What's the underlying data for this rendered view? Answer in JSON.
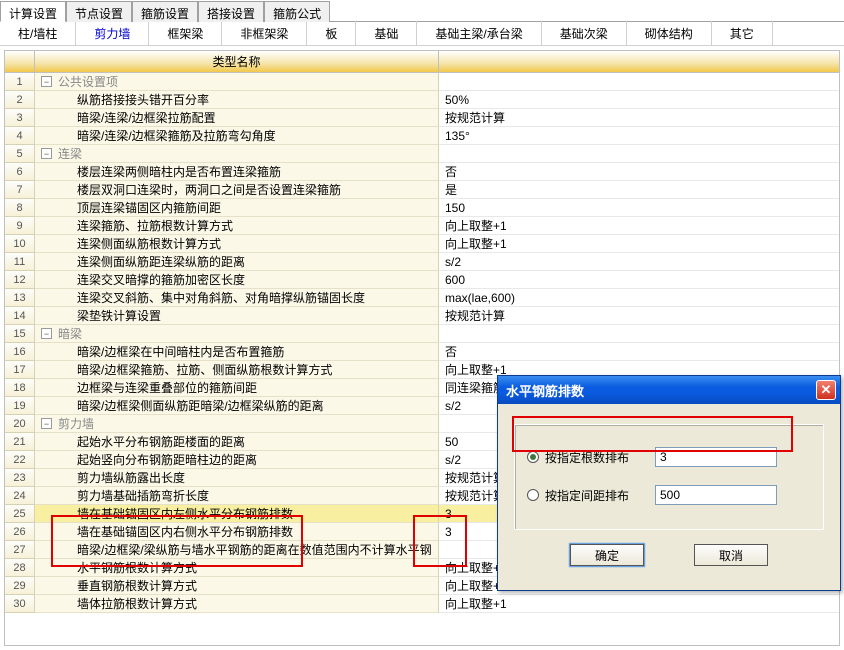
{
  "top_tabs": {
    "items": [
      "计算设置",
      "节点设置",
      "箍筋设置",
      "搭接设置",
      "箍筋公式"
    ],
    "active_index": 0
  },
  "sub_tabs": {
    "items": [
      "柱/墙柱",
      "剪力墙",
      "框架梁",
      "非框架梁",
      "板",
      "基础",
      "基础主梁/承台梁",
      "基础次梁",
      "砌体结构",
      "其它"
    ],
    "active_index": 1
  },
  "table_header": {
    "name_col": "类型名称",
    "value_col": ""
  },
  "rows": [
    {
      "n": "1",
      "group": true,
      "label": "公共设置项",
      "val": ""
    },
    {
      "n": "2",
      "label": "纵筋搭接接头错开百分率",
      "val": "50%"
    },
    {
      "n": "3",
      "label": "暗梁/连梁/边框梁拉筋配置",
      "val": "按规范计算"
    },
    {
      "n": "4",
      "label": "暗梁/连梁/边框梁箍筋及拉筋弯勾角度",
      "val": "135°"
    },
    {
      "n": "5",
      "group": true,
      "label": "连梁",
      "val": ""
    },
    {
      "n": "6",
      "label": "楼层连梁两侧暗柱内是否布置连梁箍筋",
      "val": "否"
    },
    {
      "n": "7",
      "label": "楼层双洞口连梁时，两洞口之间是否设置连梁箍筋",
      "val": "是"
    },
    {
      "n": "8",
      "label": "顶层连梁锚固区内箍筋间距",
      "val": "150"
    },
    {
      "n": "9",
      "label": "连梁箍筋、拉筋根数计算方式",
      "val": "向上取整+1"
    },
    {
      "n": "10",
      "label": "连梁侧面纵筋根数计算方式",
      "val": "向上取整+1"
    },
    {
      "n": "11",
      "label": "连梁侧面纵筋距连梁纵筋的距离",
      "val": "s/2"
    },
    {
      "n": "12",
      "label": "连梁交叉暗撑的箍筋加密区长度",
      "val": "600"
    },
    {
      "n": "13",
      "label": "连梁交叉斜筋、集中对角斜筋、对角暗撑纵筋锚固长度",
      "val": "max(lae,600)"
    },
    {
      "n": "14",
      "label": "梁垫铁计算设置",
      "val": "按规范计算"
    },
    {
      "n": "15",
      "group": true,
      "label": "暗梁",
      "val": ""
    },
    {
      "n": "16",
      "label": "暗梁/边框梁在中间暗柱内是否布置箍筋",
      "val": "否"
    },
    {
      "n": "17",
      "label": "暗梁/边框梁箍筋、拉筋、侧面纵筋根数计算方式",
      "val": "向上取整+1"
    },
    {
      "n": "18",
      "label": "边框梁与连梁重叠部位的箍筋间距",
      "val": "同连梁箍筋间距"
    },
    {
      "n": "19",
      "label": "暗梁/边框梁侧面纵筋距暗梁/边框梁纵筋的距离",
      "val": "s/2"
    },
    {
      "n": "20",
      "group": true,
      "label": "剪力墙",
      "val": ""
    },
    {
      "n": "21",
      "label": "起始水平分布钢筋距楼面的距离",
      "val": "50"
    },
    {
      "n": "22",
      "label": "起始竖向分布钢筋距暗柱边的距离",
      "val": "s/2"
    },
    {
      "n": "23",
      "label": "剪力墙纵筋露出长度",
      "val": "按规范计算"
    },
    {
      "n": "24",
      "label": "剪力墙基础插筋弯折长度",
      "val": "按规范计算"
    },
    {
      "n": "25",
      "label": "墙在基础锚固区内左侧水平分布钢筋排数",
      "val": "3",
      "selected": true
    },
    {
      "n": "26",
      "label": "墙在基础锚固区内右侧水平分布钢筋排数",
      "val": "3"
    },
    {
      "n": "27",
      "label": "暗梁/边框梁/梁纵筋与墙水平钢筋的距离在数值范围内不计算水平钢",
      "val": ""
    },
    {
      "n": "28",
      "label": "水平钢筋根数计算方式",
      "val": "向上取整+1"
    },
    {
      "n": "29",
      "label": "垂直钢筋根数计算方式",
      "val": "向上取整+1"
    },
    {
      "n": "30",
      "label": "墙体拉筋根数计算方式",
      "val": "向上取整+1"
    }
  ],
  "dialog": {
    "title": "水平钢筋排数",
    "option_count_label": "按指定根数排布",
    "option_spacing_label": "按指定间距排布",
    "count_value": "3",
    "spacing_value": "500",
    "ok": "确定",
    "cancel": "取消"
  },
  "icons": {
    "minus": "−",
    "close": "✕"
  }
}
